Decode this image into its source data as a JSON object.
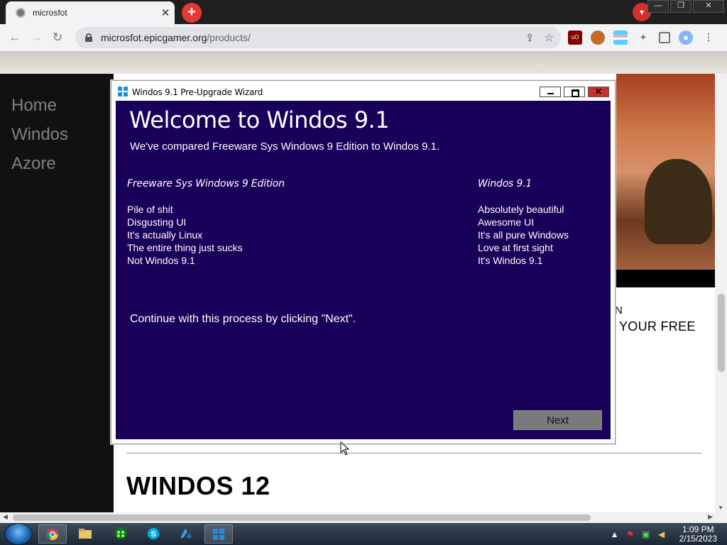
{
  "browser": {
    "tab_title": "microsfot",
    "tab_close": "✕",
    "new_tab": "+",
    "url_host": "microsfot.epicgamer.org",
    "url_path": "/products/",
    "window_controls": {
      "minimize": "—",
      "restore": "❐",
      "close": "✕"
    }
  },
  "sidebar": {
    "items": [
      {
        "label": "Home"
      },
      {
        "label": "Windos"
      },
      {
        "label": "Azore"
      }
    ]
  },
  "page": {
    "side_text_1": "N",
    "side_text_2": "YOUR FREE",
    "section_heading": "WINDOS 12"
  },
  "wizard": {
    "title": "Windos 9.1 Pre-Upgrade Wizard",
    "heading": "Welcome to Windos 9.1",
    "subtitle": "We've compared Freeware Sys Windows 9 Edition  to Windos 9.1.",
    "left_column": {
      "header": "Freeware Sys Windows 9 Edition",
      "items": [
        "Pile of shit",
        "Disgusting UI",
        "It's actually Linux",
        "The entire thing just sucks",
        "Not Windos 9.1"
      ]
    },
    "right_column": {
      "header": "Windos 9.1",
      "items": [
        "Absolutely beautiful",
        "Awesome UI",
        "It's all pure Windows",
        "Love at first sight",
        "It's Windos 9.1"
      ]
    },
    "continue_text": "Continue with this process by clicking \"Next\".",
    "next_label": "Next",
    "close_glyph": "✕"
  },
  "taskbar": {
    "apps": [
      "chrome-icon",
      "explorer-icon",
      "xbox-icon",
      "skype-icon",
      "azure-icon",
      "windows-logo-icon"
    ],
    "time": "1:09 PM",
    "date": "2/15/2023"
  },
  "colors": {
    "wizard_background": "#18005a",
    "next_button": "#7a7a7a",
    "sidebar_background": "#111111",
    "sidebar_text": "#818181"
  }
}
